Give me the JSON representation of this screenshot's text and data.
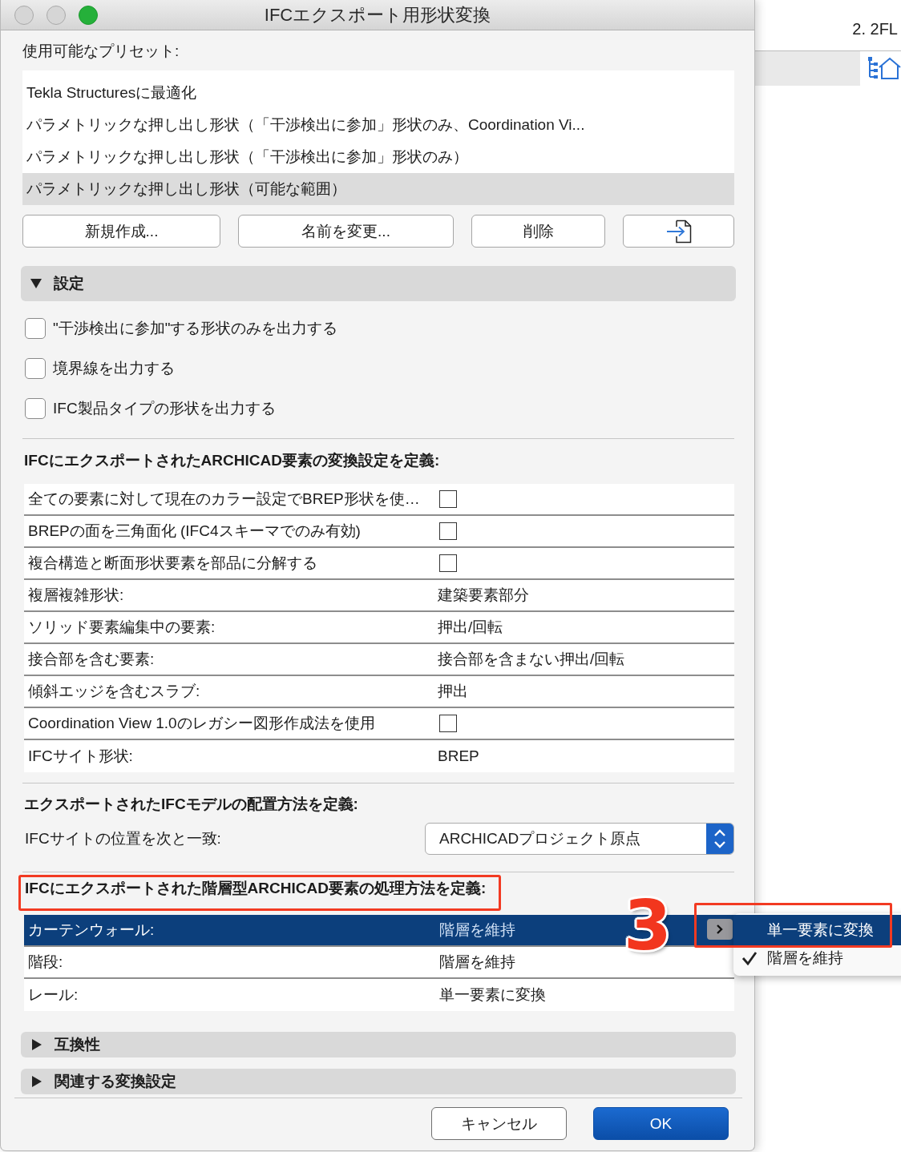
{
  "window": {
    "title": "IFCエクスポート用形状変換"
  },
  "background_window": {
    "title": "2. 2FL"
  },
  "presets": {
    "label": "使用可能なプリセット:",
    "items": [
      {
        "label": "Tekla Structuresに最適化",
        "selected": false
      },
      {
        "label": "パラメトリックな押し出し形状（「干渉検出に参加」形状のみ、Coordination Vi...",
        "selected": false
      },
      {
        "label": "パラメトリックな押し出し形状（「干渉検出に参加」形状のみ）",
        "selected": false
      },
      {
        "label": "パラメトリックな押し出し形状（可能な範囲）",
        "selected": true
      }
    ]
  },
  "preset_buttons": [
    {
      "kind": "text",
      "label": "新規作成..."
    },
    {
      "kind": "text",
      "label": "名前を変更..."
    },
    {
      "kind": "text",
      "label": "削除"
    },
    {
      "kind": "icon"
    }
  ],
  "settings": {
    "title": "設定",
    "expanded": true,
    "checkboxes": [
      {
        "label": "\"干渉検出に参加\"する形状のみを出力する",
        "checked": false
      },
      {
        "label": "境界線を出力する",
        "checked": false
      },
      {
        "label": "IFC製品タイプの形状を出力する",
        "checked": false
      }
    ],
    "conversion": {
      "heading": "IFCにエクスポートされたARCHICAD要素の変換設定を定義:",
      "rows": [
        {
          "kind": "checkbox",
          "label": "全ての要素に対して現在のカラー設定でBREP形状を使…",
          "checked": false
        },
        {
          "kind": "checkbox",
          "label": "BREPの面を三角面化 (IFC4スキーマでのみ有効)",
          "checked": false
        },
        {
          "kind": "checkbox",
          "label": "複合構造と断面形状要素を部品に分解する",
          "checked": false
        },
        {
          "kind": "value",
          "label": "複層複雑形状:",
          "value": "建築要素部分"
        },
        {
          "kind": "value",
          "label": "ソリッド要素編集中の要素:",
          "value": "押出/回転"
        },
        {
          "kind": "value",
          "label": "接合部を含む要素:",
          "value": "接合部を含まない押出/回転"
        },
        {
          "kind": "value",
          "label": "傾斜エッジを含むスラブ:",
          "value": "押出"
        },
        {
          "kind": "checkbox",
          "label": "Coordination View 1.0のレガシー図形作成法を使用",
          "checked": false
        },
        {
          "kind": "value",
          "label": "IFCサイト形状:",
          "value": "BREP"
        }
      ]
    },
    "placement": {
      "heading": "エクスポートされたIFCモデルの配置方法を定義:",
      "label": "IFCサイトの位置を次と一致:",
      "value": "ARCHICADプロジェクト原点"
    },
    "hierarchy": {
      "heading": "IFCにエクスポートされた階層型ARCHICAD要素の処理方法を定義:",
      "annotated": true,
      "rows": [
        {
          "label": "カーテンウォール:",
          "value": "階層を維持",
          "selected": true
        },
        {
          "label": "階段:",
          "value": "階層を維持",
          "selected": false
        },
        {
          "label": "レール:",
          "value": "単一要素に変換",
          "selected": false
        }
      ]
    }
  },
  "popup_menu": {
    "annotated": true,
    "items": [
      {
        "label": "単一要素に変換",
        "selected": true,
        "checked": false
      },
      {
        "label": "階層を維持",
        "selected": false,
        "checked": true
      }
    ]
  },
  "callout": {
    "label": "3"
  },
  "collapsed_sections": [
    {
      "title": "互換性",
      "expanded": false
    },
    {
      "title": "関連する変換設定",
      "expanded": false
    }
  ],
  "footer_buttons": [
    {
      "kind": "default",
      "label": "キャンセル"
    },
    {
      "kind": "primary",
      "label": "OK"
    }
  ]
}
